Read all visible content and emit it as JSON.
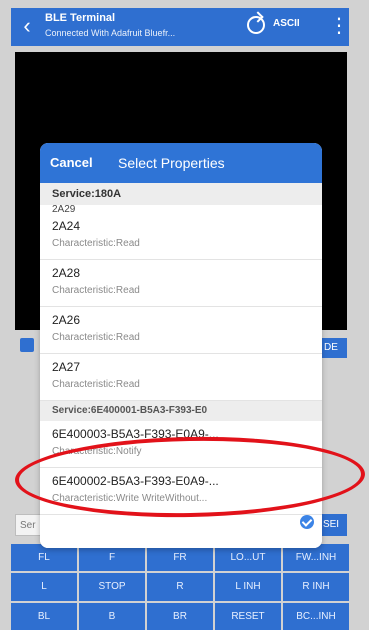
{
  "app": {
    "title": "BLE Terminal",
    "subtitle": "Connected With Adafruit Bluefr...",
    "mode_label": "ASCII"
  },
  "background": {
    "side_button": "DE",
    "send_button": "SEI",
    "input_placeholder": "Ser"
  },
  "pad": {
    "keys": [
      "FL",
      "F",
      "FR",
      "LO...UT",
      "FW...INH",
      "L",
      "STOP",
      "R",
      "L INH",
      "R INH",
      "BL",
      "B",
      "BR",
      "RESET",
      "BC...INH"
    ]
  },
  "dialog": {
    "cancel_label": "Cancel",
    "title": "Select Properties",
    "section_1": "Service:180A",
    "partial_item": "2A29",
    "items": [
      {
        "name": "2A24",
        "desc": "Characteristic:Read"
      },
      {
        "name": "2A28",
        "desc": "Characteristic:Read"
      },
      {
        "name": "2A26",
        "desc": "Characteristic:Read"
      },
      {
        "name": "2A27",
        "desc": "Characteristic:Read"
      }
    ],
    "section_2": "Service:6E400001-B5A3-F393-E0",
    "items2": [
      {
        "name": "6E400003-B5A3-F393-E0A9-...",
        "desc": "Characteristic:Notify"
      },
      {
        "name": "6E400002-B5A3-F393-E0A9-...",
        "desc": "Characteristic:Write WriteWithout..."
      }
    ]
  },
  "colors": {
    "accent": "#2f74d6",
    "highlight": "#e2121a"
  }
}
